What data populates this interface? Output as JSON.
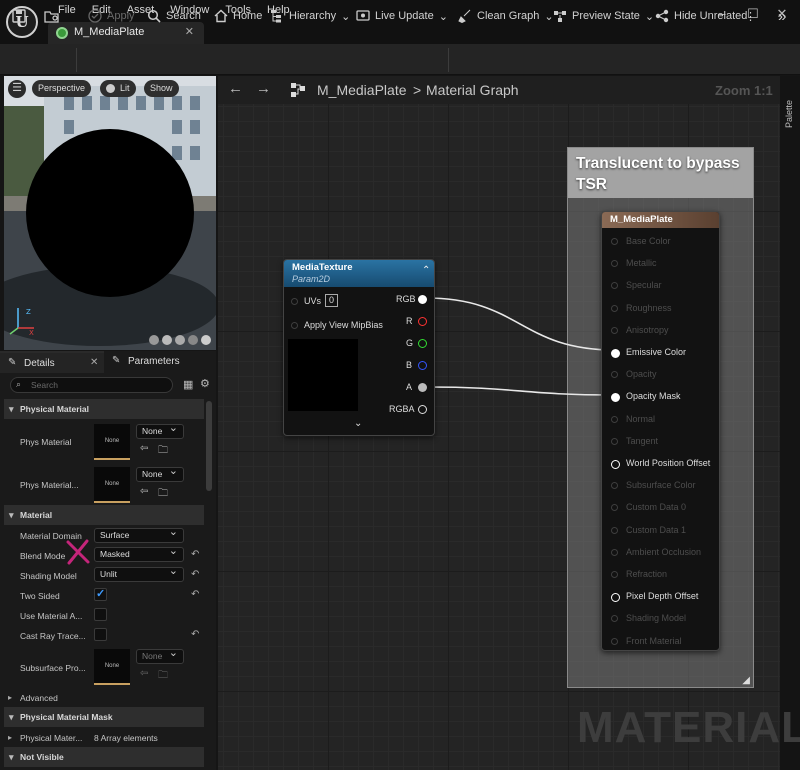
{
  "menu": [
    "File",
    "Edit",
    "Asset",
    "Window",
    "Tools",
    "Help"
  ],
  "document_tab": {
    "title": "M_MediaPlate"
  },
  "toolbar": {
    "apply": "Apply",
    "search": "Search",
    "home": "Home",
    "hierarchy": "Hierarchy",
    "live_update": "Live Update",
    "clean_graph": "Clean Graph",
    "preview_state": "Preview State",
    "hide_unrelated": "Hide Unrelated"
  },
  "viewport": {
    "perspective": "Perspective",
    "lit": "Lit",
    "show": "Show"
  },
  "details": {
    "tab_details": "Details",
    "tab_parameters": "Parameters",
    "search_placeholder": "Search",
    "sec_physical_material": "Physical Material",
    "phys_material": "Phys Material",
    "phys_material_2": "Phys Material...",
    "none": "None",
    "sec_material": "Material",
    "material_domain": "Material Domain",
    "material_domain_val": "Surface",
    "blend_mode": "Blend Mode",
    "blend_mode_val": "Masked",
    "shading_model": "Shading Model",
    "shading_model_val": "Unlit",
    "two_sided": "Two Sided",
    "use_material_a": "Use Material A...",
    "cast_ray": "Cast Ray Trace...",
    "subsurface": "Subsurface Pro...",
    "advanced": "Advanced",
    "sec_phys_mask": "Physical Material Mask",
    "physical_mater": "Physical Mater...",
    "array_elements": "8 Array elements",
    "sec_not_visible": "Not Visible"
  },
  "graph": {
    "breadcrumb_root": "M_MediaPlate",
    "breadcrumb_sep": ">",
    "breadcrumb_leaf": "Material Graph",
    "zoom": "Zoom 1:1",
    "palette": "Palette",
    "comment_title": "Translucent to bypass TSR",
    "watermark": "MATERIAL",
    "texture_node": {
      "title": "MediaTexture",
      "subtitle": "Param2D",
      "uvs": "UVs",
      "uvs_val": "0",
      "mip": "Apply View MipBias",
      "outputs": [
        "RGB",
        "R",
        "G",
        "B",
        "A",
        "RGBA"
      ]
    },
    "material_node": {
      "title": "M_MediaPlate",
      "inputs": [
        "Base Color",
        "Metallic",
        "Specular",
        "Roughness",
        "Anisotropy",
        "Emissive Color",
        "Opacity",
        "Opacity Mask",
        "Normal",
        "Tangent",
        "World Position Offset",
        "Subsurface Color",
        "Custom Data 0",
        "Custom Data 1",
        "Ambient Occlusion",
        "Refraction",
        "Pixel Depth Offset",
        "Shading Model",
        "Front Material"
      ],
      "active": [
        false,
        false,
        false,
        false,
        false,
        true,
        false,
        true,
        false,
        false,
        true,
        false,
        false,
        false,
        false,
        false,
        true,
        false,
        false
      ]
    }
  },
  "colors": {
    "accent_annotation": "#c4257a",
    "node_header_tex": "#1d5f86",
    "material_header": "#7a5a45"
  }
}
